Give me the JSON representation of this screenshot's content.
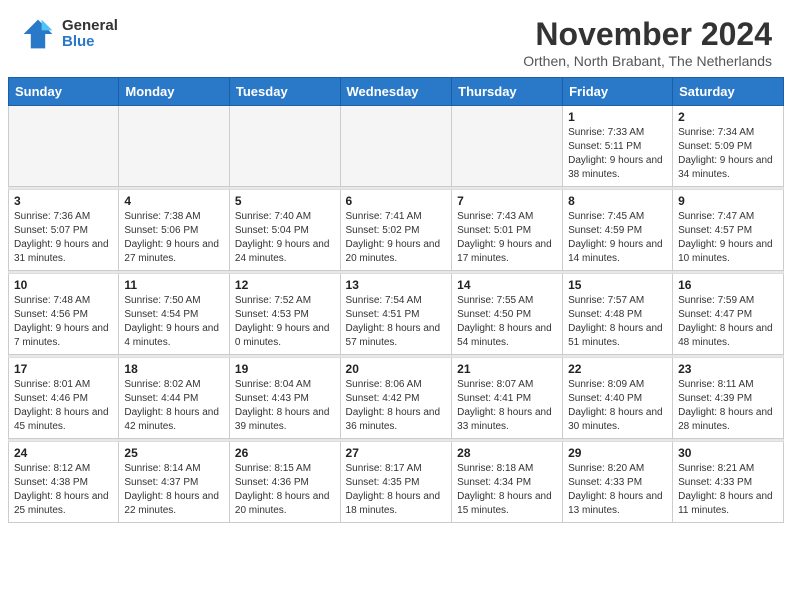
{
  "logo": {
    "general": "General",
    "blue": "Blue"
  },
  "title": "November 2024",
  "location": "Orthen, North Brabant, The Netherlands",
  "weekdays": [
    "Sunday",
    "Monday",
    "Tuesday",
    "Wednesday",
    "Thursday",
    "Friday",
    "Saturday"
  ],
  "weeks": [
    [
      {
        "day": "",
        "sunrise": "",
        "sunset": "",
        "daylight": ""
      },
      {
        "day": "",
        "sunrise": "",
        "sunset": "",
        "daylight": ""
      },
      {
        "day": "",
        "sunrise": "",
        "sunset": "",
        "daylight": ""
      },
      {
        "day": "",
        "sunrise": "",
        "sunset": "",
        "daylight": ""
      },
      {
        "day": "",
        "sunrise": "",
        "sunset": "",
        "daylight": ""
      },
      {
        "day": "1",
        "sunrise": "Sunrise: 7:33 AM",
        "sunset": "Sunset: 5:11 PM",
        "daylight": "Daylight: 9 hours and 38 minutes."
      },
      {
        "day": "2",
        "sunrise": "Sunrise: 7:34 AM",
        "sunset": "Sunset: 5:09 PM",
        "daylight": "Daylight: 9 hours and 34 minutes."
      }
    ],
    [
      {
        "day": "3",
        "sunrise": "Sunrise: 7:36 AM",
        "sunset": "Sunset: 5:07 PM",
        "daylight": "Daylight: 9 hours and 31 minutes."
      },
      {
        "day": "4",
        "sunrise": "Sunrise: 7:38 AM",
        "sunset": "Sunset: 5:06 PM",
        "daylight": "Daylight: 9 hours and 27 minutes."
      },
      {
        "day": "5",
        "sunrise": "Sunrise: 7:40 AM",
        "sunset": "Sunset: 5:04 PM",
        "daylight": "Daylight: 9 hours and 24 minutes."
      },
      {
        "day": "6",
        "sunrise": "Sunrise: 7:41 AM",
        "sunset": "Sunset: 5:02 PM",
        "daylight": "Daylight: 9 hours and 20 minutes."
      },
      {
        "day": "7",
        "sunrise": "Sunrise: 7:43 AM",
        "sunset": "Sunset: 5:01 PM",
        "daylight": "Daylight: 9 hours and 17 minutes."
      },
      {
        "day": "8",
        "sunrise": "Sunrise: 7:45 AM",
        "sunset": "Sunset: 4:59 PM",
        "daylight": "Daylight: 9 hours and 14 minutes."
      },
      {
        "day": "9",
        "sunrise": "Sunrise: 7:47 AM",
        "sunset": "Sunset: 4:57 PM",
        "daylight": "Daylight: 9 hours and 10 minutes."
      }
    ],
    [
      {
        "day": "10",
        "sunrise": "Sunrise: 7:48 AM",
        "sunset": "Sunset: 4:56 PM",
        "daylight": "Daylight: 9 hours and 7 minutes."
      },
      {
        "day": "11",
        "sunrise": "Sunrise: 7:50 AM",
        "sunset": "Sunset: 4:54 PM",
        "daylight": "Daylight: 9 hours and 4 minutes."
      },
      {
        "day": "12",
        "sunrise": "Sunrise: 7:52 AM",
        "sunset": "Sunset: 4:53 PM",
        "daylight": "Daylight: 9 hours and 0 minutes."
      },
      {
        "day": "13",
        "sunrise": "Sunrise: 7:54 AM",
        "sunset": "Sunset: 4:51 PM",
        "daylight": "Daylight: 8 hours and 57 minutes."
      },
      {
        "day": "14",
        "sunrise": "Sunrise: 7:55 AM",
        "sunset": "Sunset: 4:50 PM",
        "daylight": "Daylight: 8 hours and 54 minutes."
      },
      {
        "day": "15",
        "sunrise": "Sunrise: 7:57 AM",
        "sunset": "Sunset: 4:48 PM",
        "daylight": "Daylight: 8 hours and 51 minutes."
      },
      {
        "day": "16",
        "sunrise": "Sunrise: 7:59 AM",
        "sunset": "Sunset: 4:47 PM",
        "daylight": "Daylight: 8 hours and 48 minutes."
      }
    ],
    [
      {
        "day": "17",
        "sunrise": "Sunrise: 8:01 AM",
        "sunset": "Sunset: 4:46 PM",
        "daylight": "Daylight: 8 hours and 45 minutes."
      },
      {
        "day": "18",
        "sunrise": "Sunrise: 8:02 AM",
        "sunset": "Sunset: 4:44 PM",
        "daylight": "Daylight: 8 hours and 42 minutes."
      },
      {
        "day": "19",
        "sunrise": "Sunrise: 8:04 AM",
        "sunset": "Sunset: 4:43 PM",
        "daylight": "Daylight: 8 hours and 39 minutes."
      },
      {
        "day": "20",
        "sunrise": "Sunrise: 8:06 AM",
        "sunset": "Sunset: 4:42 PM",
        "daylight": "Daylight: 8 hours and 36 minutes."
      },
      {
        "day": "21",
        "sunrise": "Sunrise: 8:07 AM",
        "sunset": "Sunset: 4:41 PM",
        "daylight": "Daylight: 8 hours and 33 minutes."
      },
      {
        "day": "22",
        "sunrise": "Sunrise: 8:09 AM",
        "sunset": "Sunset: 4:40 PM",
        "daylight": "Daylight: 8 hours and 30 minutes."
      },
      {
        "day": "23",
        "sunrise": "Sunrise: 8:11 AM",
        "sunset": "Sunset: 4:39 PM",
        "daylight": "Daylight: 8 hours and 28 minutes."
      }
    ],
    [
      {
        "day": "24",
        "sunrise": "Sunrise: 8:12 AM",
        "sunset": "Sunset: 4:38 PM",
        "daylight": "Daylight: 8 hours and 25 minutes."
      },
      {
        "day": "25",
        "sunrise": "Sunrise: 8:14 AM",
        "sunset": "Sunset: 4:37 PM",
        "daylight": "Daylight: 8 hours and 22 minutes."
      },
      {
        "day": "26",
        "sunrise": "Sunrise: 8:15 AM",
        "sunset": "Sunset: 4:36 PM",
        "daylight": "Daylight: 8 hours and 20 minutes."
      },
      {
        "day": "27",
        "sunrise": "Sunrise: 8:17 AM",
        "sunset": "Sunset: 4:35 PM",
        "daylight": "Daylight: 8 hours and 18 minutes."
      },
      {
        "day": "28",
        "sunrise": "Sunrise: 8:18 AM",
        "sunset": "Sunset: 4:34 PM",
        "daylight": "Daylight: 8 hours and 15 minutes."
      },
      {
        "day": "29",
        "sunrise": "Sunrise: 8:20 AM",
        "sunset": "Sunset: 4:33 PM",
        "daylight": "Daylight: 8 hours and 13 minutes."
      },
      {
        "day": "30",
        "sunrise": "Sunrise: 8:21 AM",
        "sunset": "Sunset: 4:33 PM",
        "daylight": "Daylight: 8 hours and 11 minutes."
      }
    ]
  ]
}
